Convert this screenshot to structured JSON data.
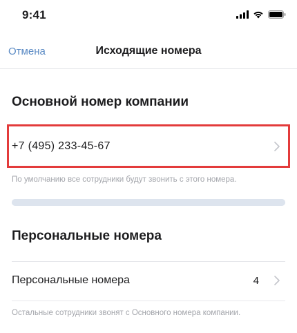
{
  "status_bar": {
    "time": "9:41",
    "icons": [
      "signal-icon",
      "wifi-icon",
      "battery-icon"
    ]
  },
  "nav": {
    "cancel_label": "Отмена",
    "title": "Исходящие номера"
  },
  "main_section": {
    "title": "Основной номер компании",
    "phone": "+7 (495) 233-45-67",
    "hint": "По умолчанию все сотрудники будут звонить с этого номера."
  },
  "progress": {
    "fraction": 1.0
  },
  "personal_section": {
    "title": "Персональные номера",
    "row_label": "Персональные номера",
    "count": "4",
    "hint": "Остальные сотрудники звонят с Основного номера компании."
  },
  "colors": {
    "accent": "#5a8ac4",
    "highlight": "#e33b3b",
    "hint_text": "#a3a5ab"
  }
}
